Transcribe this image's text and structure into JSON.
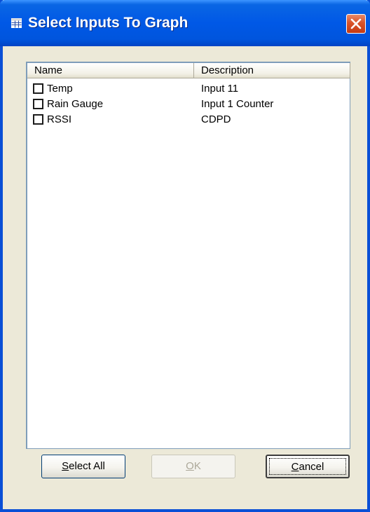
{
  "window": {
    "title": "Select Inputs To Graph",
    "title_icon": "table-icon",
    "close_icon": "close-icon",
    "colors": {
      "titlebar": "#0058E6",
      "close_button": "#D9532A",
      "face": "#ECE9D8"
    }
  },
  "list": {
    "columns": [
      "Name",
      "Description"
    ],
    "rows": [
      {
        "name": "Temp",
        "description": "Input 11",
        "checked": false
      },
      {
        "name": "Rain Gauge",
        "description": "Input 1 Counter",
        "checked": false
      },
      {
        "name": "RSSI",
        "description": "CDPD",
        "checked": false
      }
    ]
  },
  "buttons": {
    "select_all": {
      "mnemonic": "S",
      "rest": "elect All",
      "enabled": true
    },
    "ok": {
      "mnemonic": "O",
      "rest": "K",
      "enabled": false
    },
    "cancel": {
      "mnemonic": "C",
      "rest": "ancel",
      "enabled": true
    }
  }
}
